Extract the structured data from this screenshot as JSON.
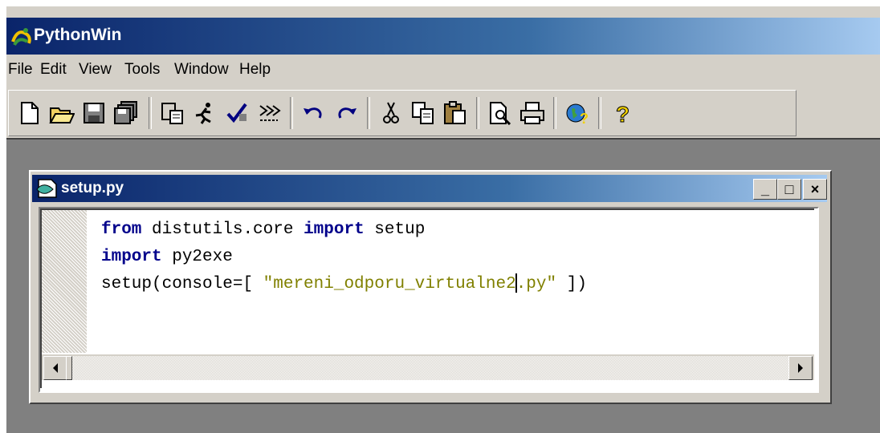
{
  "app": {
    "title": "PythonWin"
  },
  "menu": [
    "File",
    "Edit",
    "View",
    "Tools",
    "Window",
    "Help"
  ],
  "toolbar": {
    "icons": [
      "new-file-icon",
      "open-file-icon",
      "save-icon",
      "save-all-icon",
      "paste-icon",
      "run-icon",
      "check-icon",
      "import-icon",
      "undo-icon",
      "redo-icon",
      "cut-icon",
      "copy-icon",
      "paste-clipboard-icon",
      "print-preview-icon",
      "print-icon",
      "help-icon",
      "context-help-icon"
    ]
  },
  "child": {
    "title": "setup.py",
    "buttons": {
      "minimize": "_",
      "maximize": "□",
      "close": "×"
    }
  },
  "editor": {
    "lines": [
      [
        {
          "t": "from",
          "k": "kw"
        },
        {
          "t": " distutils.core ",
          "k": "plain"
        },
        {
          "t": "import",
          "k": "kw"
        },
        {
          "t": " setup",
          "k": "plain"
        }
      ],
      [
        {
          "t": "import",
          "k": "kw"
        },
        {
          "t": " py2exe",
          "k": "plain"
        }
      ],
      [
        {
          "t": "setup(console=[ ",
          "k": "plain"
        },
        {
          "t": "\"mereni_odporu_virtualne2",
          "k": "str"
        },
        {
          "t": "",
          "k": "caret"
        },
        {
          "t": ".py\"",
          "k": "str"
        },
        {
          "t": " ])",
          "k": "plain"
        }
      ]
    ]
  },
  "colors": {
    "titlebar_start": "#0a246a",
    "titlebar_end": "#a6caf0",
    "keyword": "#00008b",
    "string": "#808000"
  }
}
